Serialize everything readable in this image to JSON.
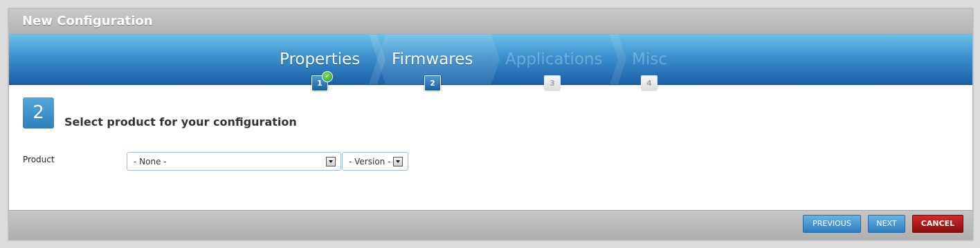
{
  "window": {
    "title": "New Configuration"
  },
  "steps": [
    {
      "label": "Properties",
      "number": "1",
      "state": "completed"
    },
    {
      "label": "Firmwares",
      "number": "2",
      "state": "active"
    },
    {
      "label": "Applications",
      "number": "3",
      "state": "disabled"
    },
    {
      "label": "Misc",
      "number": "4",
      "state": "disabled"
    }
  ],
  "content": {
    "step_number": "2",
    "heading": "Select product for your configuration",
    "product_label": "Product",
    "product_select": {
      "value": "- None -"
    },
    "version_select": {
      "value": "- Version -"
    }
  },
  "footer": {
    "previous_label": "PREVIOUS",
    "next_label": "NEXT",
    "cancel_label": "CANCEL"
  },
  "colors": {
    "accent": "#2c7fbd",
    "cancel": "#b01414",
    "completed_check": "#3aa832"
  }
}
